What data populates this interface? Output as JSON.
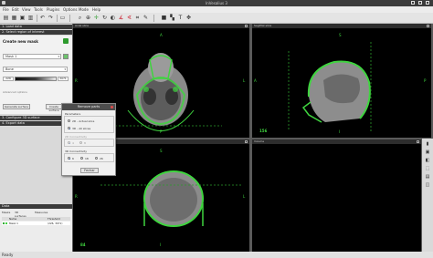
{
  "window": {
    "title": "InVesalius 3"
  },
  "menu": [
    "File",
    "Edit",
    "View",
    "Tools",
    "Plugins",
    "Options",
    "Mode",
    "Help"
  ],
  "left_panel": {
    "sections": {
      "load_data": "1. Load data",
      "select_roi": "2. Select region of interest",
      "configure_surface": "3. Configure 3D surface",
      "export_data": "4. Export data"
    },
    "create_mask": {
      "heading": "Create new mask",
      "mask_name": "Mask 1",
      "preset": "Bone",
      "thresh_min": "226",
      "thresh_max": "3071",
      "edition_label": "Advanced options",
      "generate_button": "Generate surface",
      "create_button": "Create surface"
    }
  },
  "viewports": {
    "axial": {
      "title": "Axial slice",
      "top": "A",
      "bottom": "P",
      "left": "R",
      "right": "L",
      "slice": ""
    },
    "sagittal": {
      "title": "Sagittal slice",
      "top": "S",
      "bottom": "I",
      "left": "A",
      "right": "P",
      "slice": "156"
    },
    "coronal": {
      "title": "Coronal slice",
      "top": "S",
      "bottom": "I",
      "left": "R",
      "right": "L",
      "slice": "84"
    },
    "volume": {
      "title": "Volume"
    }
  },
  "dialog": {
    "title": "Remove parts",
    "parameters_label": "Parameters",
    "opt_2d": "2D - Actual slice",
    "opt_3d": "3D - All slices",
    "conn2d_label": "2D Connectivity",
    "conn2d_values": [
      "4",
      "8"
    ],
    "conn3d_label": "3D Connectivity",
    "conn3d_values": [
      "6",
      "18",
      "26"
    ],
    "close_button": "Fechar"
  },
  "data_panel": {
    "header": "Data",
    "tabs": [
      "Masks",
      "3D surfaces",
      "Measures"
    ],
    "columns": [
      "Name",
      "Threshold"
    ],
    "rows": [
      {
        "name": "Mask 1",
        "threshold": "(226, 3071)"
      }
    ]
  },
  "statusbar": {
    "text": "Ready"
  },
  "colors": {
    "mask_green": "#3fd43f",
    "panel_dark": "#3a3a3a",
    "viewport_bg": "#000000"
  }
}
